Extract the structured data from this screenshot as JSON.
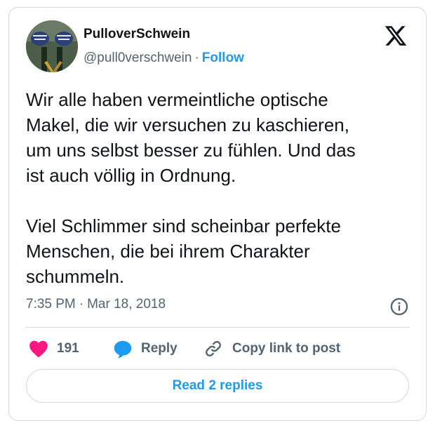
{
  "author": {
    "name": "PulloverSchwein",
    "handle": "@pull0verschwein",
    "separator": "·",
    "follow_label": "Follow",
    "avatar_icon": "avatar-sneakers-photo"
  },
  "brand": {
    "logo_icon": "x-logo-icon"
  },
  "tweet": {
    "text": "Wir alle haben vermeintliche optische\nMakel, die wir versuchen zu kaschieren,\num uns selbst besser zu fühlen. Und das\nist auch völlig in Ordnung.\n\nViel Schlimmer sind scheinbar perfekte\nMenschen, die bei ihrem Charakter\nschummeln.",
    "time": "7:35 PM",
    "separator": "·",
    "date": "Mar 18, 2018"
  },
  "actions": {
    "like_count": "191",
    "reply_label": "Reply",
    "copy_label": "Copy link to post"
  },
  "replies_button_label": "Read 2 replies",
  "colors": {
    "accent": "#1d9bf0",
    "like": "#f91880",
    "text": "#0f1419",
    "muted": "#536471",
    "border": "#cfd9de"
  }
}
